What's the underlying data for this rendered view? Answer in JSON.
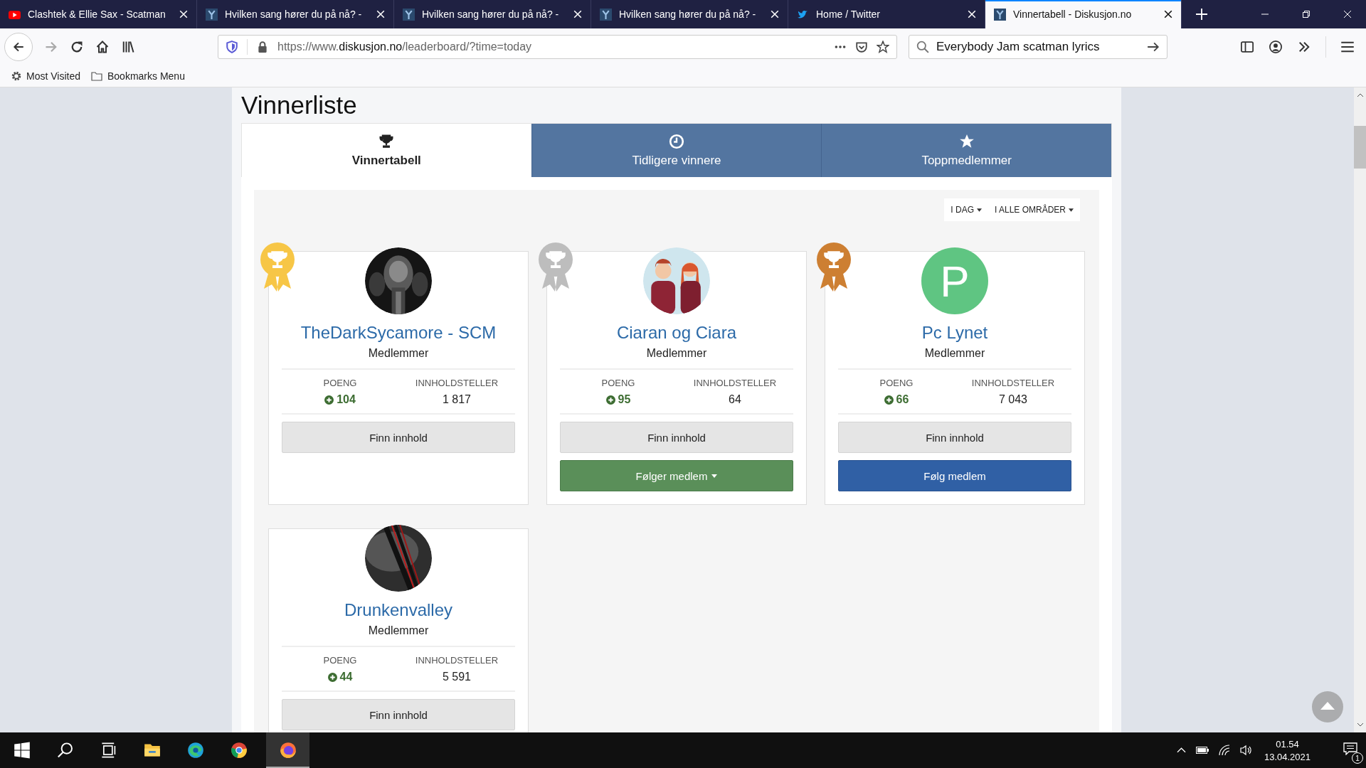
{
  "browser_tabs": [
    {
      "title": "Clashtek & Ellie Sax - Scatman",
      "kind": "youtube",
      "selected": false
    },
    {
      "title": "Hvilken sang hører du på nå? -",
      "kind": "site",
      "selected": false
    },
    {
      "title": "Hvilken sang hører du på nå? -",
      "kind": "site",
      "selected": false
    },
    {
      "title": "Hvilken sang hører du på nå? -",
      "kind": "site",
      "selected": false
    },
    {
      "title": "Home / Twitter",
      "kind": "bird",
      "selected": false
    },
    {
      "title": "Vinnertabell - Diskusjon.no",
      "kind": "site",
      "selected": true
    }
  ],
  "address_bar": {
    "prefix": "https://www.",
    "domain": "diskusjon.no",
    "path": "/leaderboard/?time=today"
  },
  "search_field": {
    "value": "Everybody Jam scatman lyrics"
  },
  "bookmarks": [
    {
      "label": "Most Visited",
      "kind": "gear"
    },
    {
      "label": "Bookmarks Menu",
      "kind": "folder"
    }
  ],
  "page": {
    "title": "Vinnerliste",
    "tabs": [
      {
        "label": "Vinnertabell",
        "kind": "trophy",
        "selected": true
      },
      {
        "label": "Tidligere vinnere",
        "kind": "clock",
        "selected": false
      },
      {
        "label": "Toppmedlemmer",
        "kind": "star",
        "selected": false
      }
    ],
    "filters": [
      {
        "label": "I DAG"
      },
      {
        "label": "I ALLE OMRÅDER"
      }
    ],
    "members": [
      {
        "name": "TheDarkSycamore - SCM",
        "role": "Medlemmer",
        "color": "#f7c646",
        "points_label": "POENG",
        "points": "104",
        "count_label": "INNHOLDSTELLER",
        "count": "1 817",
        "find_button": "Finn innhold"
      },
      {
        "name": "Ciaran og Ciara",
        "role": "Medlemmer",
        "color": "#bdbdbd",
        "points_label": "POENG",
        "points": "95",
        "count_label": "INNHOLDSTELLER",
        "count": "64",
        "find_button": "Finn innhold",
        "follow_button": {
          "label": "Følger medlem",
          "kind": "following"
        }
      },
      {
        "name": "Pc Lynet",
        "role": "Medlemmer",
        "color": "#cd7f32",
        "avatar": {
          "kind": "letter",
          "letter": "P"
        },
        "points_label": "POENG",
        "points": "66",
        "count_label": "INNHOLDSTELLER",
        "count": "7 043",
        "find_button": "Finn innhold",
        "follow_button": {
          "label": "Følg medlem",
          "kind": "follow"
        }
      },
      {
        "name": "Drunkenvalley",
        "role": "Medlemmer",
        "points_label": "POENG",
        "points": "44",
        "count_label": "INNHOLDSTELLER",
        "count": "5 591",
        "find_button": "Finn innhold"
      }
    ]
  },
  "taskbar": {
    "apps": [
      {
        "kind": "start",
        "selected": false
      },
      {
        "kind": "search",
        "selected": false
      },
      {
        "kind": "taskview",
        "selected": false
      },
      {
        "kind": "explorer",
        "selected": false
      },
      {
        "kind": "edge",
        "selected": false
      },
      {
        "kind": "chrome",
        "selected": false
      },
      {
        "kind": "firefox",
        "selected": true
      }
    ],
    "time": "01.54",
    "date": "13.04.2021",
    "notifications": "1"
  }
}
